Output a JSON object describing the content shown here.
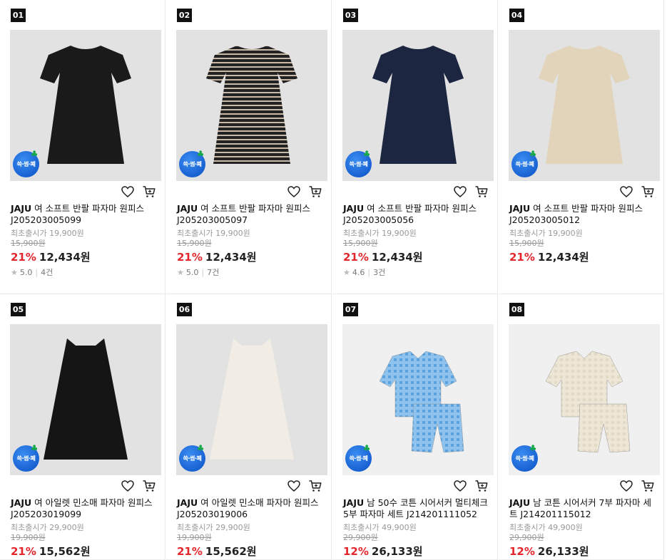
{
  "products": [
    {
      "rank": "01",
      "brand": "JAJU",
      "title": "여 소프트 반팔 파자마 원피스 J205203005099",
      "orig_label": "최초출시가 19,900원",
      "strike_price": "15,900원",
      "discount": "21%",
      "price": "12,434원",
      "rating": "5.0",
      "reviews": "4건",
      "badge": "쓱·썸·폐",
      "garment": "dress",
      "color": "#1a1a1a",
      "stripe": false
    },
    {
      "rank": "02",
      "brand": "JAJU",
      "title": "여 소프트 반팔 파자마 원피스 J205203005097",
      "orig_label": "최초출시가 19,900원",
      "strike_price": "15,900원",
      "discount": "21%",
      "price": "12,434원",
      "rating": "5.0",
      "reviews": "7건",
      "badge": "쓱·썸·폐",
      "garment": "dress",
      "color": "#2a2a2a",
      "stripe": true
    },
    {
      "rank": "03",
      "brand": "JAJU",
      "title": "여 소프트 반팔 파자마 원피스 J205203005056",
      "orig_label": "최초출시가 19,900원",
      "strike_price": "15,900원",
      "discount": "21%",
      "price": "12,434원",
      "rating": "4.6",
      "reviews": "3건",
      "badge": "쓱·썸·폐",
      "garment": "dress",
      "color": "#1c2640",
      "stripe": false
    },
    {
      "rank": "04",
      "brand": "JAJU",
      "title": "여 소프트 반팔 파자마 원피스 J205203005012",
      "orig_label": "최초출시가 19,900원",
      "strike_price": "15,900원",
      "discount": "21%",
      "price": "12,434원",
      "rating": "",
      "reviews": "",
      "badge": "쓱·썸·폐",
      "garment": "dress",
      "color": "#e2d4bb",
      "stripe": false
    },
    {
      "rank": "05",
      "brand": "JAJU",
      "title": "여 아일렛 민소매 파자마 원피스 J205203019099",
      "orig_label": "최초출시가 29,900원",
      "strike_price": "19,900원",
      "discount": "21%",
      "price": "15,562원",
      "rating": "",
      "reviews": "",
      "badge": "쓱·썸·폐",
      "garment": "sleeveless",
      "color": "#151515",
      "stripe": false
    },
    {
      "rank": "06",
      "brand": "JAJU",
      "title": "여 아일렛 민소매 파자마 원피스 J205203019006",
      "orig_label": "최초출시가 29,900원",
      "strike_price": "19,900원",
      "discount": "21%",
      "price": "15,562원",
      "rating": "",
      "reviews": "",
      "badge": "쓱·썸·폐",
      "garment": "sleeveless",
      "color": "#f1ede4",
      "stripe": false
    },
    {
      "rank": "07",
      "brand": "JAJU",
      "title": "남 50수 코튼 시어서커 멀티체크 5부 파자마 세트 J214201111052",
      "orig_label": "최초출시가 49,900원",
      "strike_price": "29,900원",
      "discount": "12%",
      "price": "26,133원",
      "rating": "",
      "reviews": "",
      "badge": "쓱·썸·폐",
      "garment": "set",
      "color": "#8fc3ee",
      "stripe": false
    },
    {
      "rank": "08",
      "brand": "JAJU",
      "title": "남 코튼 시어서커 7부 파자마 세트 J214201115012",
      "orig_label": "최초출시가 49,900원",
      "strike_price": "29,900원",
      "discount": "12%",
      "price": "26,133원",
      "rating": "",
      "reviews": "",
      "badge": "쓱·썸·폐",
      "garment": "set",
      "color": "#ede6d6",
      "stripe": false
    }
  ]
}
